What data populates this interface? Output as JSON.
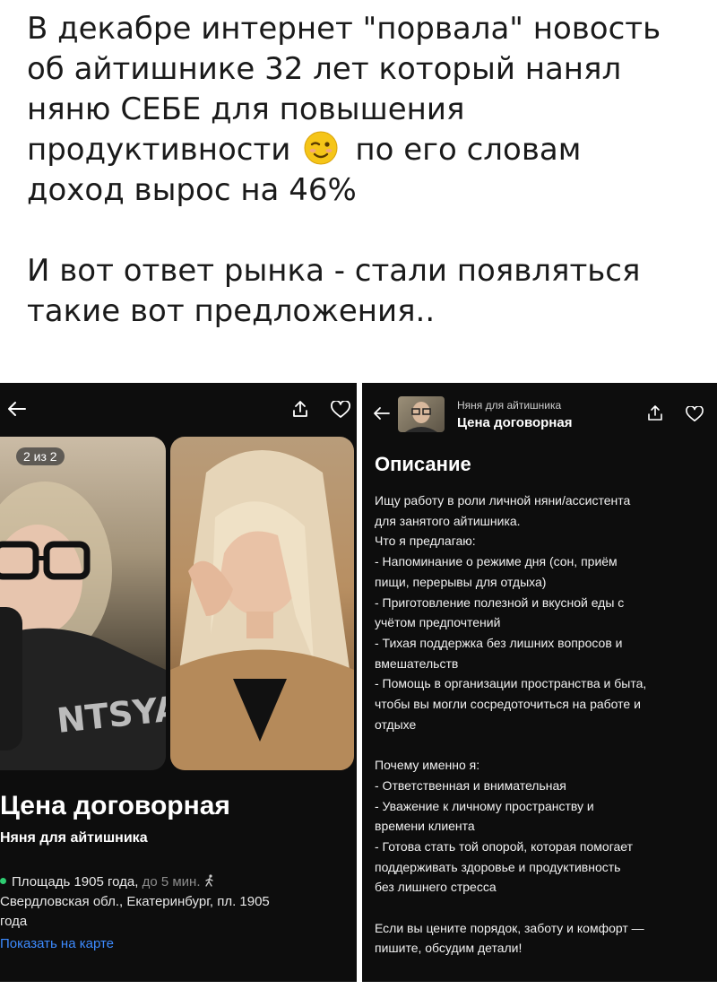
{
  "post": {
    "line1": "В декабре интернет \"порвала\" новость",
    "line2": "об айтишнике 32 лет который нанял",
    "line3": "няню СЕБЕ для повышения",
    "line4a": "продуктивности",
    "line4b": "по его словам",
    "line5": "доход вырос на 46%",
    "line6": "И вот ответ рынка - стали появляться",
    "line7": "такие вот предложения.."
  },
  "listing": {
    "photo_counter": "2 из 2",
    "price": "Цена договорная",
    "title": "Няня для айтишника",
    "address_line1": "Площадь 1905 года,",
    "walk_time": "до 5 мин.",
    "address_line2": "Свердловская обл., Екатеринбург, пл. 1905",
    "address_line3": "года",
    "map_link": "Показать на карте"
  },
  "details": {
    "header_title": "Няня для айтишника",
    "header_price": "Цена договорная",
    "heading": "Описание",
    "lines": [
      "Ищу работу в роли личной няни/ассистента",
      "для занятого айтишника.",
      "Что я предлагаю:",
      "- Напоминание о режиме дня (сон, приём",
      "пищи, перерывы для отдыха)",
      "- Приготовление полезной и вкусной еды с",
      "учётом предпочтений",
      "- Тихая поддержка без лишних вопросов и",
      "вмешательств",
      "- Помощь в организации пространства и быта,",
      "чтобы вы могли сосредоточиться на работе и",
      "отдыхе",
      "",
      "Почему именно я:",
      "- Ответственная и внимательная",
      "- Уважение к личному пространству и",
      "времени клиента",
      "- Готова стать той опорой, которая помогает",
      "поддерживать здоровье и продуктивность",
      "без лишнего стресса",
      "",
      "Если вы цените порядок, заботу и комфорт —",
      "пишите, обсудим детали!"
    ]
  },
  "icons": {
    "back": "arrow-left-icon",
    "share": "share-icon",
    "favorite": "heart-icon",
    "emoji": "winking-face-emoji",
    "walk": "walking-person-icon"
  },
  "colors": {
    "panel_bg": "#0d0d0d",
    "link": "#3d8bff",
    "metro_dot": "#2ecc71"
  }
}
